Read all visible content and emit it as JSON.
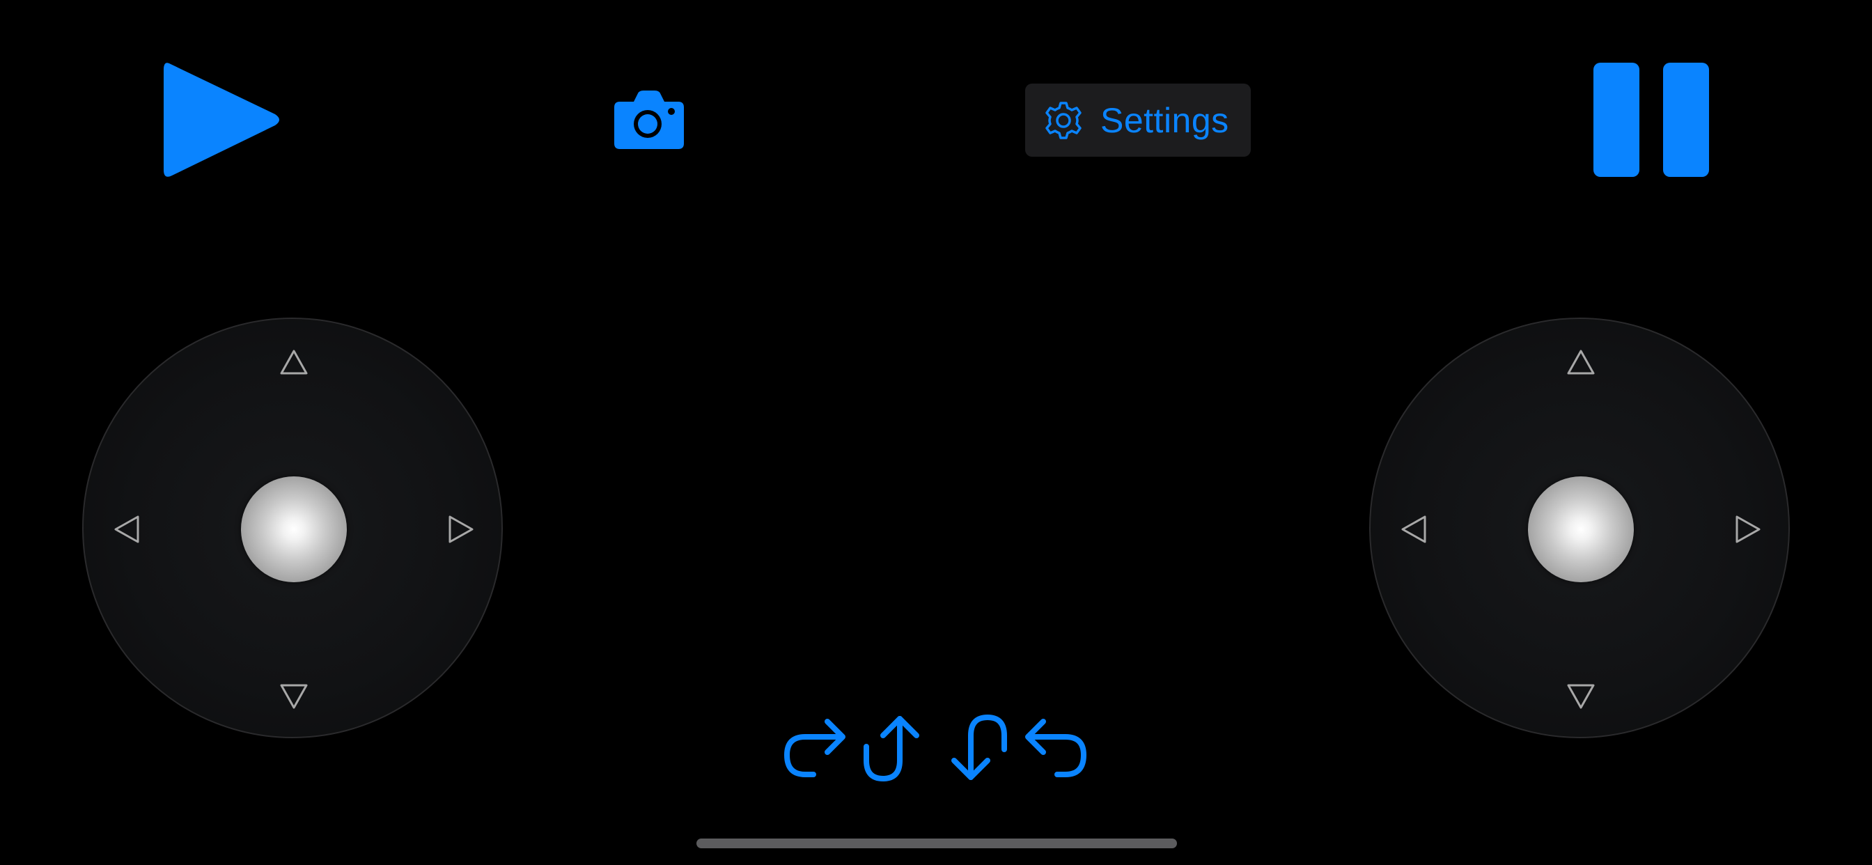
{
  "theme": {
    "accent_color": "#0a84ff",
    "background_color": "#000000",
    "panel_color": "#1c1c1e"
  },
  "toolbar": {
    "play_icon": "play-icon",
    "camera_icon": "camera-icon",
    "settings_icon": "gear-icon",
    "settings_label": "Settings",
    "pause_icon": "pause-icon"
  },
  "joysticks": {
    "left": {
      "arrows": [
        "up-arrow-icon",
        "down-arrow-icon",
        "left-arrow-icon",
        "right-arrow-icon"
      ],
      "knob_icon": "joystick-knob"
    },
    "right": {
      "arrows": [
        "up-arrow-icon",
        "down-arrow-icon",
        "left-arrow-icon",
        "right-arrow-icon"
      ],
      "knob_icon": "joystick-knob"
    }
  },
  "maneuvers": [
    {
      "icon": "redo-arrow-icon"
    },
    {
      "icon": "u-turn-up-icon"
    },
    {
      "icon": "u-turn-down-icon"
    },
    {
      "icon": "undo-arrow-icon"
    }
  ]
}
